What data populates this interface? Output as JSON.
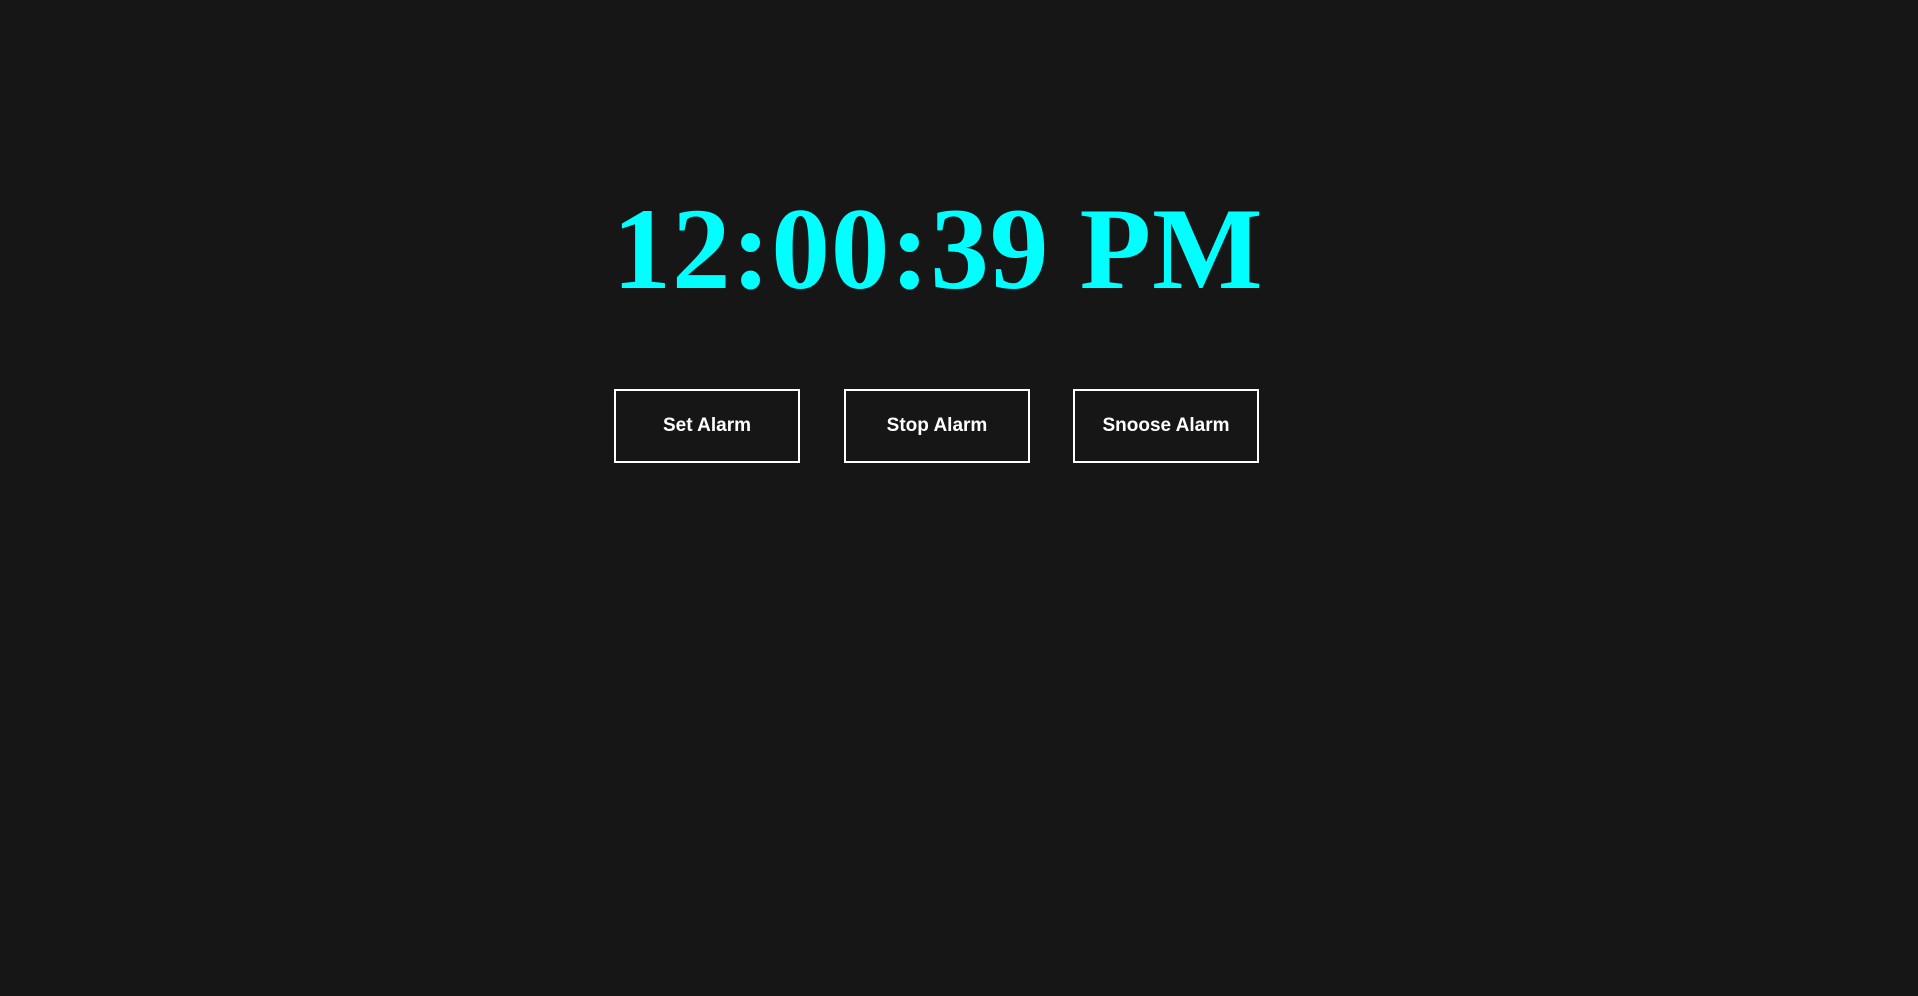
{
  "clock": {
    "time": "12:00:39 PM",
    "color": "#00ffff"
  },
  "buttons": {
    "set_label": "Set Alarm",
    "stop_label": "Stop Alarm",
    "snooze_label": "Snoose Alarm"
  },
  "theme": {
    "background": "#161616",
    "button_border": "#ffffff",
    "button_text": "#ffffff"
  }
}
